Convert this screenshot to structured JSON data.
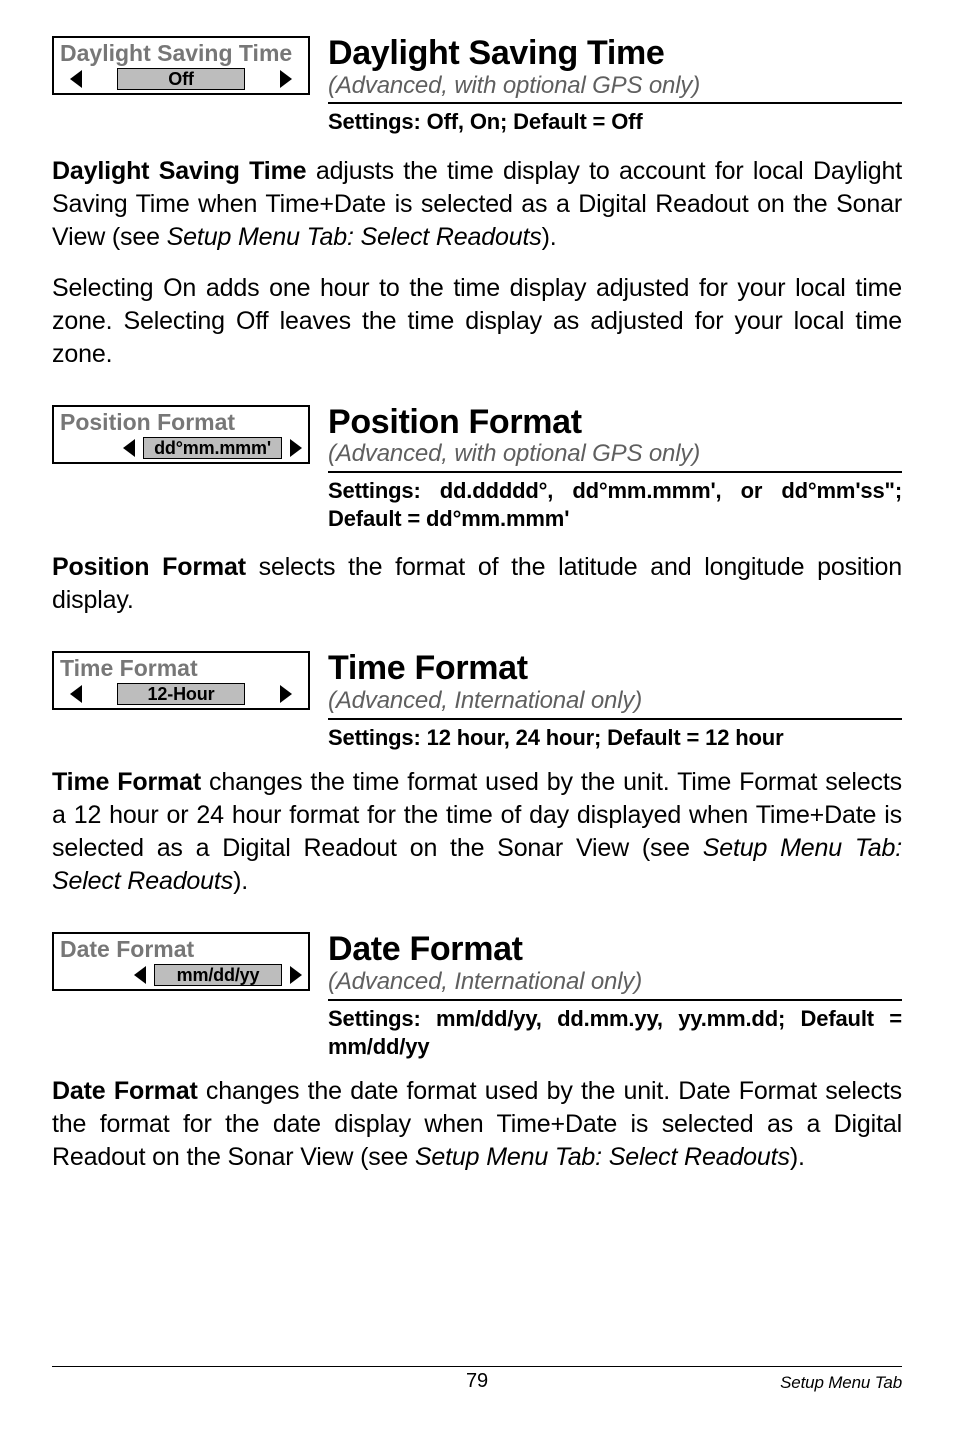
{
  "sections": [
    {
      "widget": {
        "label": "Daylight Saving Time",
        "value": "Off",
        "align": "center"
      },
      "title": "Daylight Saving Time",
      "subtitle": "(Advanced, with optional GPS only)",
      "settings": "Settings: Off, On; Default = Off",
      "body": [
        {
          "bold": "Daylight Saving Time",
          "rest": " adjusts the time display to account for local Daylight Saving Time when Time+Date is selected as a Digital Readout on the Sonar View (see ",
          "ital": "Setup Menu Tab: Select Readouts",
          "tail": ")."
        },
        {
          "para": "Selecting On adds one hour to the time display adjusted for your local time zone. Selecting Off leaves the time display as adjusted for your local time zone."
        }
      ]
    },
    {
      "widget": {
        "label": "Position Format",
        "value": "dd°mm.mmm'",
        "align": "right"
      },
      "title": "Position Format",
      "subtitle": "(Advanced, with optional GPS only)",
      "settings": "Settings: dd.ddddd°, dd°mm.mmm', or dd°mm'ss\"; Default = dd°mm.mmm'",
      "body": [
        {
          "bold": "Position Format",
          "rest": " selects the format of the latitude and longitude position display."
        }
      ]
    },
    {
      "widget": {
        "label": "Time Format",
        "value": "12-Hour",
        "align": "center"
      },
      "title": "Time Format",
      "subtitle": "(Advanced, International only)",
      "settings": "Settings: 12 hour, 24 hour; Default = 12 hour",
      "body": [
        {
          "bold": "Time Format",
          "rest": " changes the time format used by the unit. Time Format selects a 12 hour or 24 hour format for the time of day displayed when Time+Date is selected as a Digital Readout on the Sonar View (see ",
          "ital": "Setup Menu Tab: Select Readouts",
          "tail": ")."
        }
      ]
    },
    {
      "widget": {
        "label": "Date Format",
        "value": "mm/dd/yy",
        "align": "right"
      },
      "title": "Date Format",
      "subtitle": "(Advanced, International only)",
      "settings": "Settings: mm/dd/yy, dd.mm.yy, yy.mm.dd; Default = mm/dd/yy",
      "body": [
        {
          "bold": "Date Format",
          "rest": " changes the date format used by the unit. Date Format selects the format for the date display when Time+Date is selected as a Digital Readout on the Sonar View (see ",
          "ital": "Setup Menu Tab: Select Readouts",
          "tail": ")."
        }
      ]
    }
  ],
  "footer": {
    "page": "79",
    "label": "Setup Menu Tab"
  }
}
